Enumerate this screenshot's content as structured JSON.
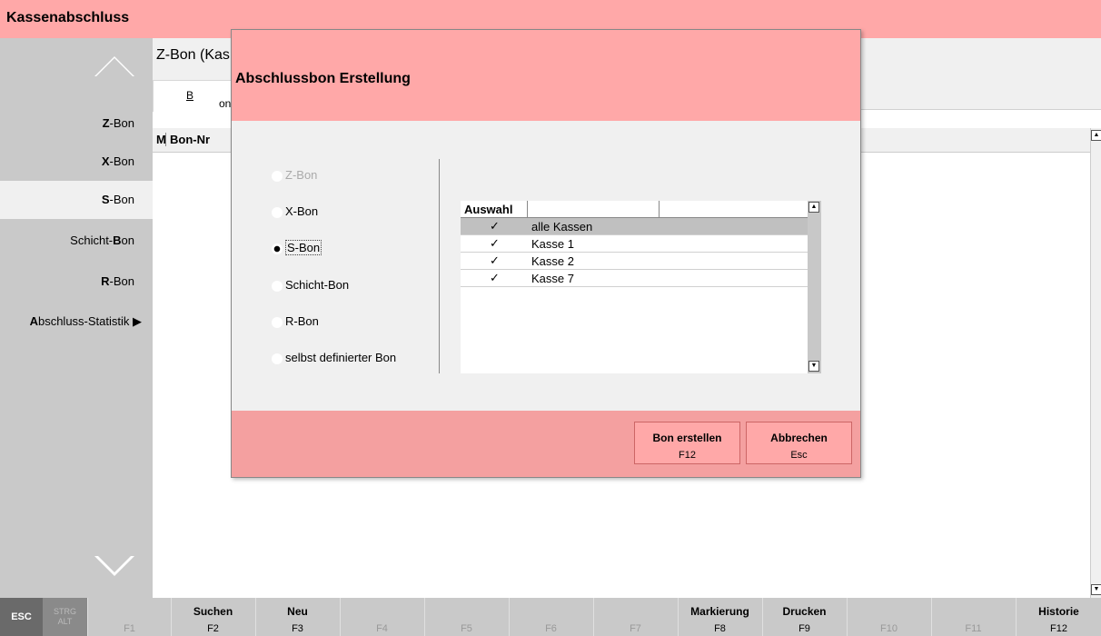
{
  "app": {
    "title": "Kassenabschluss"
  },
  "sidebar": {
    "items": [
      {
        "bold": "Z",
        "rest": "-Bon"
      },
      {
        "bold": "X",
        "rest": "-Bon"
      },
      {
        "bold": "S",
        "rest": "-Bon"
      },
      {
        "pre": "Schicht-",
        "bold": "B",
        "rest": "on"
      },
      {
        "bold": "R",
        "rest": "-Bon"
      },
      {
        "bold": "A",
        "rest": "bschluss-Statistik ▶"
      }
    ]
  },
  "main": {
    "heading": "Z-Bon (Kas",
    "tab": {
      "underline": "B",
      "rest": "onübe"
    },
    "columns": [
      "M",
      "Bon-Nr"
    ]
  },
  "dialog": {
    "title": "Abschlussbon Erstellung",
    "options": [
      "Z-Bon",
      "X-Bon",
      "S-Bon",
      "Schicht-Bon",
      "R-Bon",
      "selbst definierter Bon"
    ],
    "selected_option": "S-Bon",
    "grid": {
      "header": "Auswahl",
      "rows": [
        {
          "check": "✓",
          "name": "alle Kassen"
        },
        {
          "check": "✓",
          "name": "Kasse 1"
        },
        {
          "check": "✓",
          "name": "Kasse 2"
        },
        {
          "check": "✓",
          "name": "Kasse 7"
        }
      ]
    },
    "buttons": [
      {
        "label": "Bon erstellen",
        "key": "F12"
      },
      {
        "label": "Abbrechen",
        "key": "Esc"
      }
    ]
  },
  "fkeys": {
    "esc": "ESC",
    "strg": "STRG",
    "alt": "ALT",
    "keys": [
      {
        "label": "",
        "key": "F1"
      },
      {
        "label": "Suchen",
        "key": "F2"
      },
      {
        "label": "Neu",
        "key": "F3"
      },
      {
        "label": "",
        "key": "F4"
      },
      {
        "label": "",
        "key": "F5"
      },
      {
        "label": "",
        "key": "F6"
      },
      {
        "label": "",
        "key": "F7"
      },
      {
        "label": "Markierung",
        "key": "F8"
      },
      {
        "label": "Drucken",
        "key": "F9"
      },
      {
        "label": "",
        "key": "F10"
      },
      {
        "label": "",
        "key": "F11"
      },
      {
        "label": "Historie",
        "key": "F12"
      }
    ]
  },
  "colors": {
    "accent": "#ffa8a8",
    "panel": "#c9c9c9"
  }
}
